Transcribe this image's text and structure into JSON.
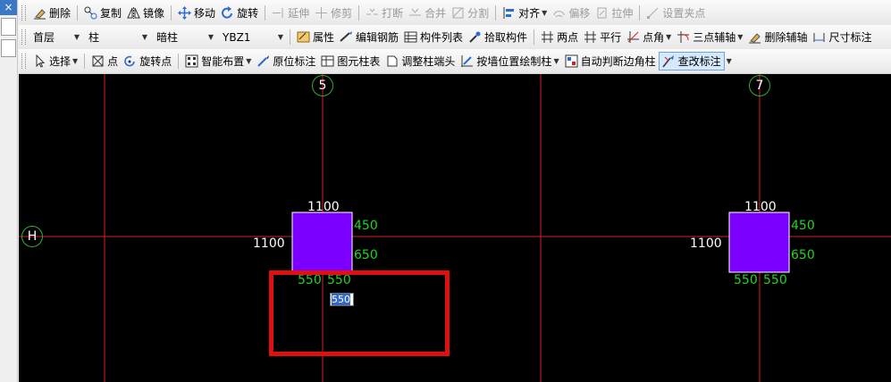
{
  "left_strip": {
    "close_glyph": "×"
  },
  "toolbar1": [
    {
      "label": "删除",
      "icon": "eraser-icon",
      "enabled": true
    },
    {
      "label": "复制",
      "icon": "copy-icon",
      "enabled": true
    },
    {
      "label": "镜像",
      "icon": "mirror-icon",
      "enabled": true
    },
    {
      "label": "移动",
      "icon": "move-icon",
      "enabled": true
    },
    {
      "label": "旋转",
      "icon": "rotate-icon",
      "enabled": true
    },
    {
      "label": "延伸",
      "icon": "extend-icon",
      "enabled": false
    },
    {
      "label": "修剪",
      "icon": "trim-icon",
      "enabled": false
    },
    {
      "label": "打断",
      "icon": "break-icon",
      "enabled": false
    },
    {
      "label": "合并",
      "icon": "merge-icon",
      "enabled": false
    },
    {
      "label": "分割",
      "icon": "split-icon",
      "enabled": false
    },
    {
      "label": "对齐",
      "icon": "align-icon",
      "enabled": true,
      "dropdown": true
    },
    {
      "label": "偏移",
      "icon": "offset-icon",
      "enabled": false
    },
    {
      "label": "拉伸",
      "icon": "stretch-icon",
      "enabled": false
    },
    {
      "label": "设置夹点",
      "icon": "grip-point-icon",
      "enabled": false
    }
  ],
  "toolbar2": {
    "floor_select": "首层",
    "category_select": "柱",
    "type_select": "暗柱",
    "element_select": "YBZ1",
    "buttons": [
      {
        "label": "属性",
        "icon": "properties-icon"
      },
      {
        "label": "编辑钢筋",
        "icon": "edit-rebar-icon"
      },
      {
        "label": "构件列表",
        "icon": "component-list-icon"
      },
      {
        "label": "拾取构件",
        "icon": "eyedropper-icon"
      },
      {
        "label": "两点",
        "icon": "two-point-icon"
      },
      {
        "label": "平行",
        "icon": "parallel-icon"
      },
      {
        "label": "点角",
        "icon": "point-angle-icon",
        "dropdown": true
      },
      {
        "label": "三点辅轴",
        "icon": "three-point-axis-icon",
        "dropdown": true
      },
      {
        "label": "删除辅轴",
        "icon": "delete-axis-icon"
      },
      {
        "label": "尺寸标注",
        "icon": "dimension-icon"
      }
    ]
  },
  "toolbar3": [
    {
      "label": "选择",
      "icon": "cursor-icon",
      "dropdown": true
    },
    {
      "label": "点",
      "icon": "point-icon"
    },
    {
      "label": "旋转点",
      "icon": "rotate-point-icon"
    },
    {
      "label": "智能布置",
      "icon": "smart-layout-icon",
      "dropdown": true
    },
    {
      "label": "原位标注",
      "icon": "inplace-annotation-icon"
    },
    {
      "label": "图元柱表",
      "icon": "column-table-icon"
    },
    {
      "label": "调整柱端头",
      "icon": "adjust-column-end-icon"
    },
    {
      "label": "按墙位置绘制柱",
      "icon": "draw-by-wall-icon",
      "dropdown": true
    },
    {
      "label": "自动判断边角柱",
      "icon": "auto-corner-column-icon"
    },
    {
      "label": "查改标注",
      "icon": "check-annotation-icon",
      "dropdown": true,
      "active": true
    }
  ],
  "canvas": {
    "axis_labels": {
      "axis5": "5",
      "axis7": "7",
      "axisH": "H"
    },
    "column_left": {
      "top": "1100",
      "left": "1100",
      "right_upper": "450",
      "right_lower": "650",
      "bottom_left": "550",
      "bottom_right": "550"
    },
    "column_right": {
      "top": "1100",
      "left": "1100",
      "right_upper": "450",
      "right_lower": "650",
      "bottom_left": "550",
      "bottom_right": "550"
    },
    "edit_value": "550",
    "colors": {
      "background": "#000000",
      "grid_line": "#d42020",
      "column_fill": "#7b00ff",
      "dim_green": "#22d422",
      "dim_white": "#ffffff",
      "highlight": "#e01010"
    }
  }
}
